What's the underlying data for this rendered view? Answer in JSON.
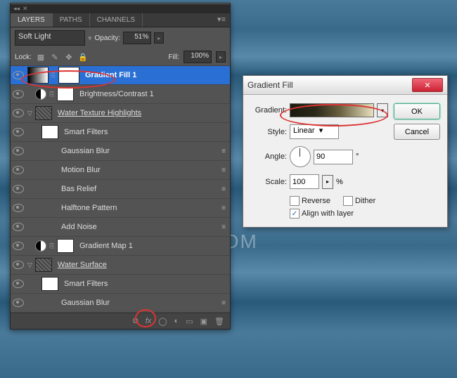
{
  "watermark": "WWW.PSD-DUDE.COM",
  "tabs": {
    "layers": "LAYERS",
    "paths": "PATHS",
    "channels": "CHANNELS"
  },
  "blend_mode": "Soft Light",
  "opacity_label": "Opacity:",
  "opacity_value": "51%",
  "lock_label": "Lock:",
  "fill_label": "Fill:",
  "fill_value": "100%",
  "layers": {
    "gradient_fill": "Gradient Fill 1",
    "brightness": "Brightness/Contrast 1",
    "highlights": "Water Texture Highlights",
    "smart_filters": "Smart Filters",
    "gauss": "Gaussian Blur",
    "motion": "Motion Blur",
    "bas": "Bas Relief",
    "halftone": "Halftone Pattern",
    "noise": "Add Noise",
    "gradmap": "Gradient Map 1",
    "surface": "Water Surface",
    "gauss2": "Gaussian Blur"
  },
  "dialog": {
    "title": "Gradient Fill",
    "ok": "OK",
    "cancel": "Cancel",
    "gradient_label": "Gradient:",
    "style_label": "Style:",
    "style_value": "Linear",
    "angle_label": "Angle:",
    "angle_value": "90",
    "angle_unit": "°",
    "scale_label": "Scale:",
    "scale_value": "100",
    "scale_unit": "%",
    "reverse": "Reverse",
    "dither": "Dither",
    "align": "Align with layer"
  }
}
